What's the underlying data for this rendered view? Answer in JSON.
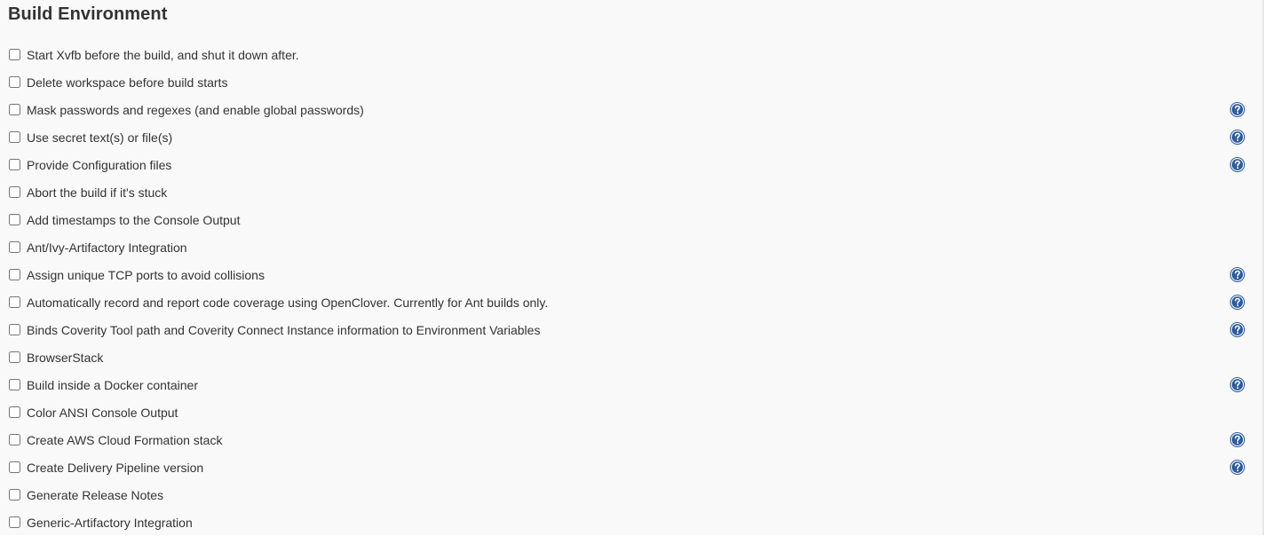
{
  "section": {
    "title": "Build Environment"
  },
  "colors": {
    "panel_background": "#f9f9f9",
    "text": "#333333",
    "help_icon_fill": "#2f5d9e"
  },
  "options": [
    {
      "label": "Start Xvfb before the build, and shut it down after.",
      "checked": false,
      "help": false
    },
    {
      "label": "Delete workspace before build starts",
      "checked": false,
      "help": false
    },
    {
      "label": "Mask passwords and regexes (and enable global passwords)",
      "checked": false,
      "help": true
    },
    {
      "label": "Use secret text(s) or file(s)",
      "checked": false,
      "help": true
    },
    {
      "label": "Provide Configuration files",
      "checked": false,
      "help": true
    },
    {
      "label": "Abort the build if it's stuck",
      "checked": false,
      "help": false
    },
    {
      "label": "Add timestamps to the Console Output",
      "checked": false,
      "help": false
    },
    {
      "label": "Ant/Ivy-Artifactory Integration",
      "checked": false,
      "help": false
    },
    {
      "label": "Assign unique TCP ports to avoid collisions",
      "checked": false,
      "help": true
    },
    {
      "label": "Automatically record and report code coverage using OpenClover. Currently for Ant builds only.",
      "checked": false,
      "help": true
    },
    {
      "label": "Binds Coverity Tool path and Coverity Connect Instance information to Environment Variables",
      "checked": false,
      "help": true
    },
    {
      "label": "BrowserStack",
      "checked": false,
      "help": false
    },
    {
      "label": "Build inside a Docker container",
      "checked": false,
      "help": true
    },
    {
      "label": "Color ANSI Console Output",
      "checked": false,
      "help": false
    },
    {
      "label": "Create AWS Cloud Formation stack",
      "checked": false,
      "help": true
    },
    {
      "label": "Create Delivery Pipeline version",
      "checked": false,
      "help": true
    },
    {
      "label": "Generate Release Notes",
      "checked": false,
      "help": false
    },
    {
      "label": "Generic-Artifactory Integration",
      "checked": false,
      "help": false
    }
  ]
}
